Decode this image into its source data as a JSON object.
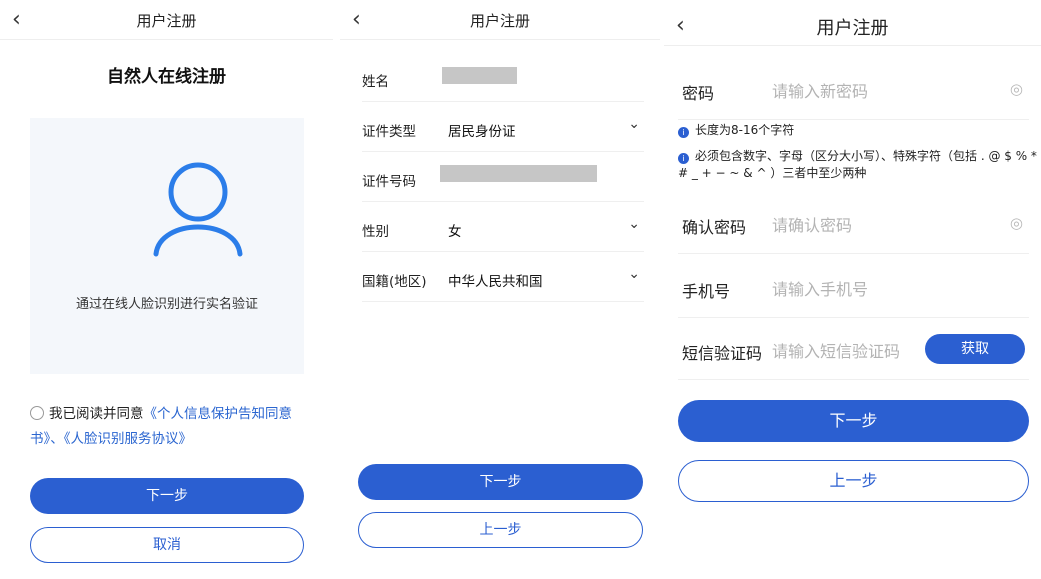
{
  "panel1": {
    "back_icon": "chevron-left-icon",
    "title": "用户注册",
    "heading": "自然人在线注册",
    "face_icon": "user-icon",
    "face_text": "通过在线人脸识别进行实名验证",
    "agree_prefix": "我已阅读并同意",
    "agree_link1": "《个人信息保护告知同意书》",
    "agree_sep": "、",
    "agree_link2": "《人脸识别服务协议》",
    "next_label": "下一步",
    "cancel_label": "取消",
    "accent": "#2b5fd1"
  },
  "panel2": {
    "back_icon": "chevron-left-icon",
    "title": "用户注册",
    "rows": [
      {
        "label": "姓名",
        "value": ""
      },
      {
        "label": "证件类型",
        "value": "居民身份证"
      },
      {
        "label": "证件号码",
        "value": ""
      },
      {
        "label": "性别",
        "value": "女"
      },
      {
        "label": "国籍(地区)",
        "value": "中华人民共和国"
      }
    ],
    "next_label": "下一步",
    "prev_label": "上一步"
  },
  "panel3": {
    "back_icon": "chevron-left-icon",
    "title": "用户注册",
    "password_label": "密码",
    "password_placeholder": "请输入新密码",
    "hint1": "长度为8-16个字符",
    "hint2": "必须包含数字、字母（区分大小写）、特殊字符（包括 . @ $ % * # _ + − ~ & ^ ）三者中至少两种",
    "confirm_label": "确认密码",
    "confirm_placeholder": "请确认密码",
    "phone_label": "手机号",
    "phone_placeholder": "请输入手机号",
    "sms_label": "短信验证码",
    "sms_placeholder": "请输入短信验证码",
    "sms_button": "获取",
    "next_label": "下一步",
    "prev_label": "上一步"
  }
}
